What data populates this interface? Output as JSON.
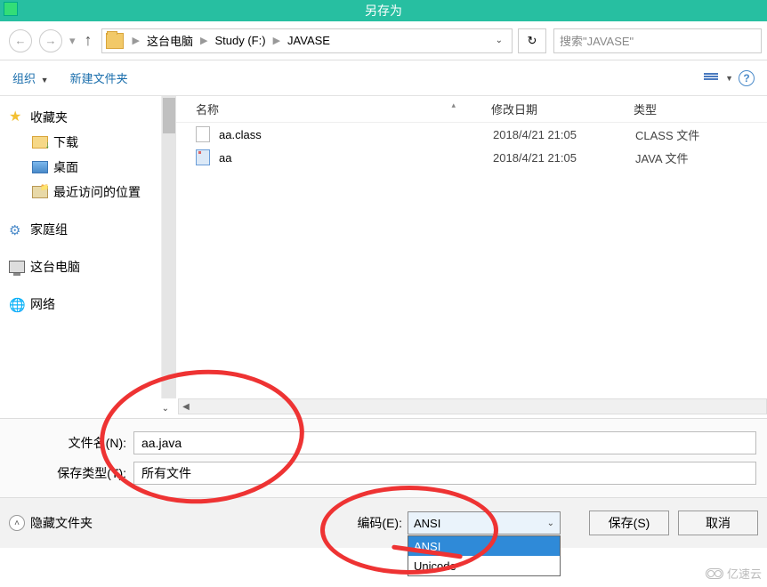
{
  "window": {
    "title": "另存为"
  },
  "breadcrumb": {
    "items": [
      "这台电脑",
      "Study (F:)",
      "JAVASE"
    ]
  },
  "search": {
    "placeholder": "搜索\"JAVASE\""
  },
  "toolbar": {
    "organize": "组织",
    "new_folder": "新建文件夹"
  },
  "sidebar": {
    "favorites": "收藏夹",
    "downloads": "下载",
    "desktop": "桌面",
    "recent": "最近访问的位置",
    "homegroup": "家庭组",
    "this_pc": "这台电脑",
    "network": "网络"
  },
  "columns": {
    "name": "名称",
    "date": "修改日期",
    "type": "类型"
  },
  "files": [
    {
      "name": "aa.class",
      "date": "2018/4/21 21:05",
      "type": "CLASS 文件",
      "kind": "class"
    },
    {
      "name": "aa",
      "date": "2018/4/21 21:05",
      "type": "JAVA 文件",
      "kind": "java"
    }
  ],
  "form": {
    "filename_label": "文件名(N):",
    "filename_value": "aa.java",
    "filetype_label": "保存类型(T):",
    "filetype_value": "所有文件"
  },
  "bottom": {
    "hide_folders": "隐藏文件夹",
    "encoding_label": "编码(E):",
    "encoding_selected": "ANSI",
    "encoding_options": [
      "ANSI",
      "Unicode"
    ],
    "save": "保存(S)",
    "cancel": "取消"
  },
  "watermark": "亿速云"
}
